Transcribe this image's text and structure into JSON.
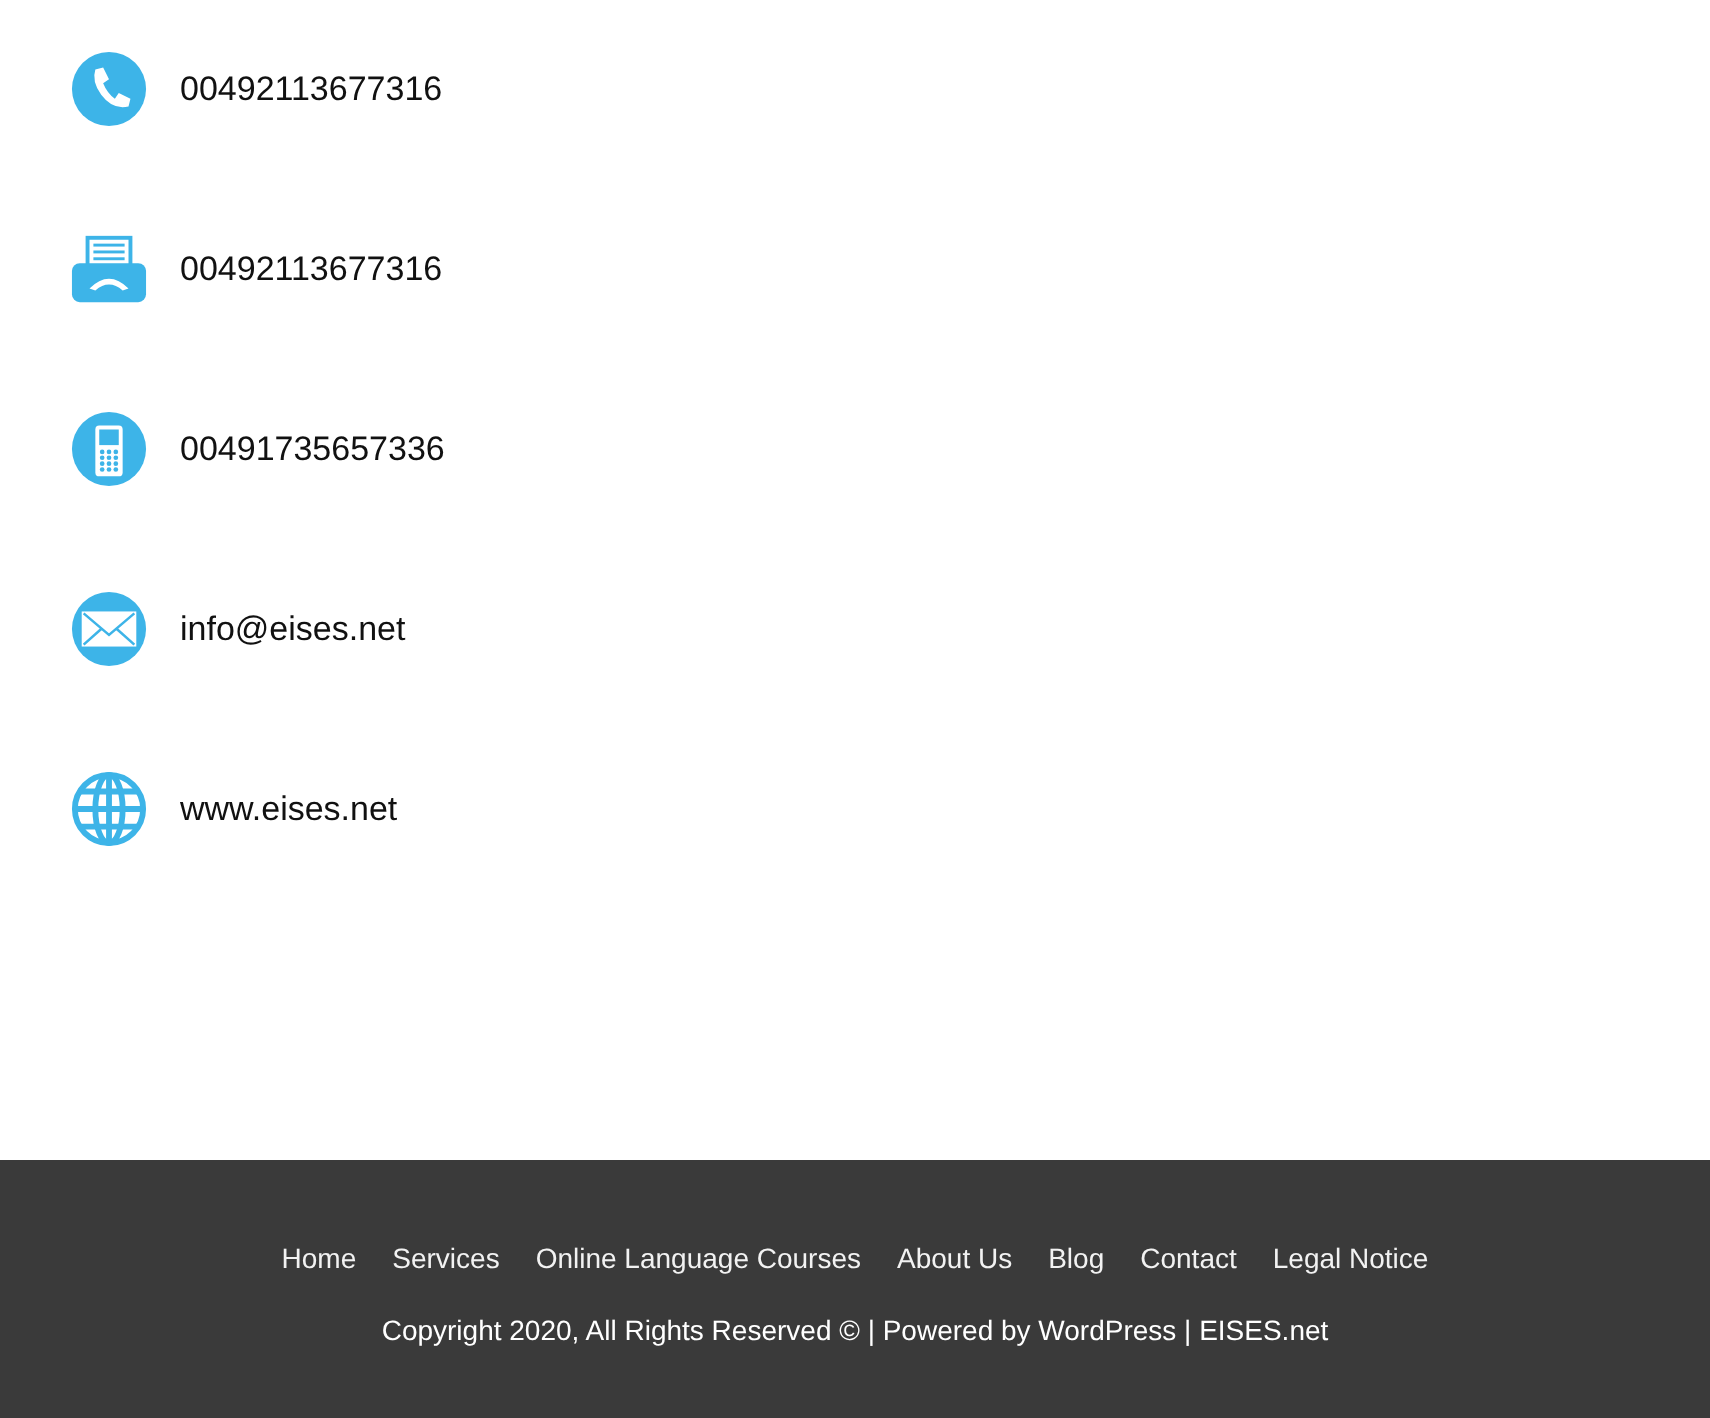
{
  "contacts": [
    {
      "kind": "phone",
      "text": "00492113677316"
    },
    {
      "kind": "fax",
      "text": "00492113677316"
    },
    {
      "kind": "mobile",
      "text": "00491735657336"
    },
    {
      "kind": "email",
      "text": "info@eises.net"
    },
    {
      "kind": "web",
      "text": "www.eises.net"
    }
  ],
  "footer": {
    "nav": [
      "Home",
      "Services",
      "Online Language Courses",
      "About Us",
      "Blog",
      "Contact",
      "Legal Notice"
    ],
    "copyright": "Copyright 2020, All Rights Reserved © | Powered by WordPress | EISES.net"
  }
}
